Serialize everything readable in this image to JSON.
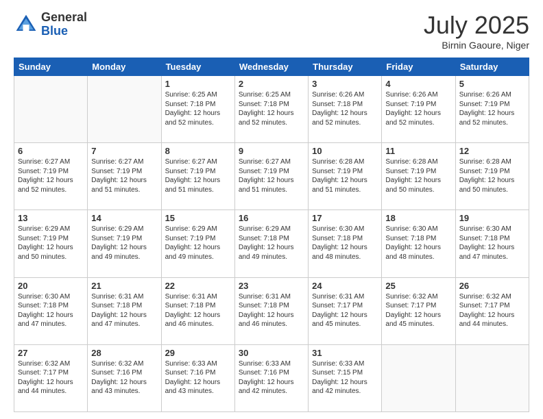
{
  "logo": {
    "general": "General",
    "blue": "Blue"
  },
  "header": {
    "month": "July 2025",
    "location": "Birnin Gaoure, Niger"
  },
  "weekdays": [
    "Sunday",
    "Monday",
    "Tuesday",
    "Wednesday",
    "Thursday",
    "Friday",
    "Saturday"
  ],
  "weeks": [
    [
      {
        "day": "",
        "info": ""
      },
      {
        "day": "",
        "info": ""
      },
      {
        "day": "1",
        "info": "Sunrise: 6:25 AM\nSunset: 7:18 PM\nDaylight: 12 hours and 52 minutes."
      },
      {
        "day": "2",
        "info": "Sunrise: 6:25 AM\nSunset: 7:18 PM\nDaylight: 12 hours and 52 minutes."
      },
      {
        "day": "3",
        "info": "Sunrise: 6:26 AM\nSunset: 7:18 PM\nDaylight: 12 hours and 52 minutes."
      },
      {
        "day": "4",
        "info": "Sunrise: 6:26 AM\nSunset: 7:19 PM\nDaylight: 12 hours and 52 minutes."
      },
      {
        "day": "5",
        "info": "Sunrise: 6:26 AM\nSunset: 7:19 PM\nDaylight: 12 hours and 52 minutes."
      }
    ],
    [
      {
        "day": "6",
        "info": "Sunrise: 6:27 AM\nSunset: 7:19 PM\nDaylight: 12 hours and 52 minutes."
      },
      {
        "day": "7",
        "info": "Sunrise: 6:27 AM\nSunset: 7:19 PM\nDaylight: 12 hours and 51 minutes."
      },
      {
        "day": "8",
        "info": "Sunrise: 6:27 AM\nSunset: 7:19 PM\nDaylight: 12 hours and 51 minutes."
      },
      {
        "day": "9",
        "info": "Sunrise: 6:27 AM\nSunset: 7:19 PM\nDaylight: 12 hours and 51 minutes."
      },
      {
        "day": "10",
        "info": "Sunrise: 6:28 AM\nSunset: 7:19 PM\nDaylight: 12 hours and 51 minutes."
      },
      {
        "day": "11",
        "info": "Sunrise: 6:28 AM\nSunset: 7:19 PM\nDaylight: 12 hours and 50 minutes."
      },
      {
        "day": "12",
        "info": "Sunrise: 6:28 AM\nSunset: 7:19 PM\nDaylight: 12 hours and 50 minutes."
      }
    ],
    [
      {
        "day": "13",
        "info": "Sunrise: 6:29 AM\nSunset: 7:19 PM\nDaylight: 12 hours and 50 minutes."
      },
      {
        "day": "14",
        "info": "Sunrise: 6:29 AM\nSunset: 7:19 PM\nDaylight: 12 hours and 49 minutes."
      },
      {
        "day": "15",
        "info": "Sunrise: 6:29 AM\nSunset: 7:19 PM\nDaylight: 12 hours and 49 minutes."
      },
      {
        "day": "16",
        "info": "Sunrise: 6:29 AM\nSunset: 7:18 PM\nDaylight: 12 hours and 49 minutes."
      },
      {
        "day": "17",
        "info": "Sunrise: 6:30 AM\nSunset: 7:18 PM\nDaylight: 12 hours and 48 minutes."
      },
      {
        "day": "18",
        "info": "Sunrise: 6:30 AM\nSunset: 7:18 PM\nDaylight: 12 hours and 48 minutes."
      },
      {
        "day": "19",
        "info": "Sunrise: 6:30 AM\nSunset: 7:18 PM\nDaylight: 12 hours and 47 minutes."
      }
    ],
    [
      {
        "day": "20",
        "info": "Sunrise: 6:30 AM\nSunset: 7:18 PM\nDaylight: 12 hours and 47 minutes."
      },
      {
        "day": "21",
        "info": "Sunrise: 6:31 AM\nSunset: 7:18 PM\nDaylight: 12 hours and 47 minutes."
      },
      {
        "day": "22",
        "info": "Sunrise: 6:31 AM\nSunset: 7:18 PM\nDaylight: 12 hours and 46 minutes."
      },
      {
        "day": "23",
        "info": "Sunrise: 6:31 AM\nSunset: 7:18 PM\nDaylight: 12 hours and 46 minutes."
      },
      {
        "day": "24",
        "info": "Sunrise: 6:31 AM\nSunset: 7:17 PM\nDaylight: 12 hours and 45 minutes."
      },
      {
        "day": "25",
        "info": "Sunrise: 6:32 AM\nSunset: 7:17 PM\nDaylight: 12 hours and 45 minutes."
      },
      {
        "day": "26",
        "info": "Sunrise: 6:32 AM\nSunset: 7:17 PM\nDaylight: 12 hours and 44 minutes."
      }
    ],
    [
      {
        "day": "27",
        "info": "Sunrise: 6:32 AM\nSunset: 7:17 PM\nDaylight: 12 hours and 44 minutes."
      },
      {
        "day": "28",
        "info": "Sunrise: 6:32 AM\nSunset: 7:16 PM\nDaylight: 12 hours and 43 minutes."
      },
      {
        "day": "29",
        "info": "Sunrise: 6:33 AM\nSunset: 7:16 PM\nDaylight: 12 hours and 43 minutes."
      },
      {
        "day": "30",
        "info": "Sunrise: 6:33 AM\nSunset: 7:16 PM\nDaylight: 12 hours and 42 minutes."
      },
      {
        "day": "31",
        "info": "Sunrise: 6:33 AM\nSunset: 7:15 PM\nDaylight: 12 hours and 42 minutes."
      },
      {
        "day": "",
        "info": ""
      },
      {
        "day": "",
        "info": ""
      }
    ]
  ]
}
